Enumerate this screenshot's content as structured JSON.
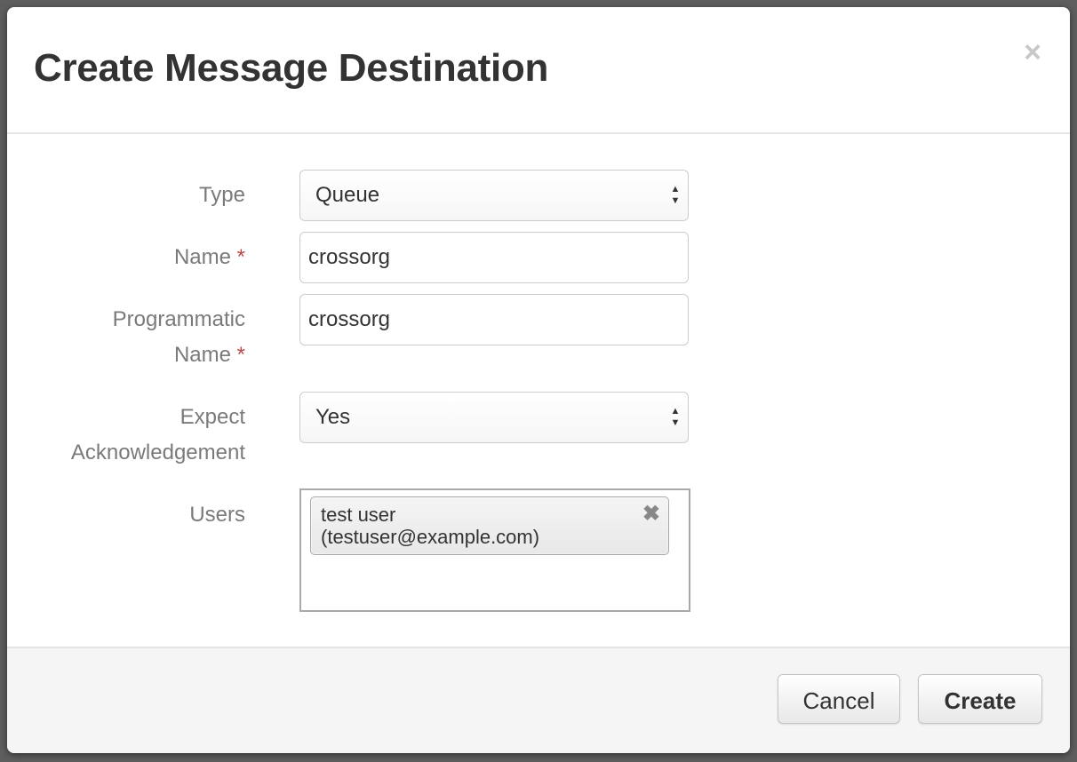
{
  "modal": {
    "title": "Create Message Destination",
    "close_label": "×"
  },
  "form": {
    "type": {
      "label": "Type",
      "value": "Queue"
    },
    "name": {
      "label": "Name",
      "required_mark": "*",
      "value": "crossorg"
    },
    "programmatic_name": {
      "label_line1": "Programmatic",
      "label_line2": "Name",
      "required_mark": "*",
      "value": "crossorg"
    },
    "expect_ack": {
      "label_line1": "Expect",
      "label_line2": "Acknowledgement",
      "value": "Yes"
    },
    "users": {
      "label": "Users",
      "selected": [
        {
          "name": "test user",
          "email": "(testuser@example.com)",
          "remove_label": "✖"
        }
      ]
    }
  },
  "footer": {
    "cancel_label": "Cancel",
    "create_label": "Create"
  },
  "colors": {
    "required": "#b94a48",
    "label": "#7a7a7a",
    "text": "#333333"
  },
  "icons": {
    "select_arrows": "up-down-arrows-icon",
    "close": "close-icon",
    "remove_tag": "remove-tag-icon"
  }
}
